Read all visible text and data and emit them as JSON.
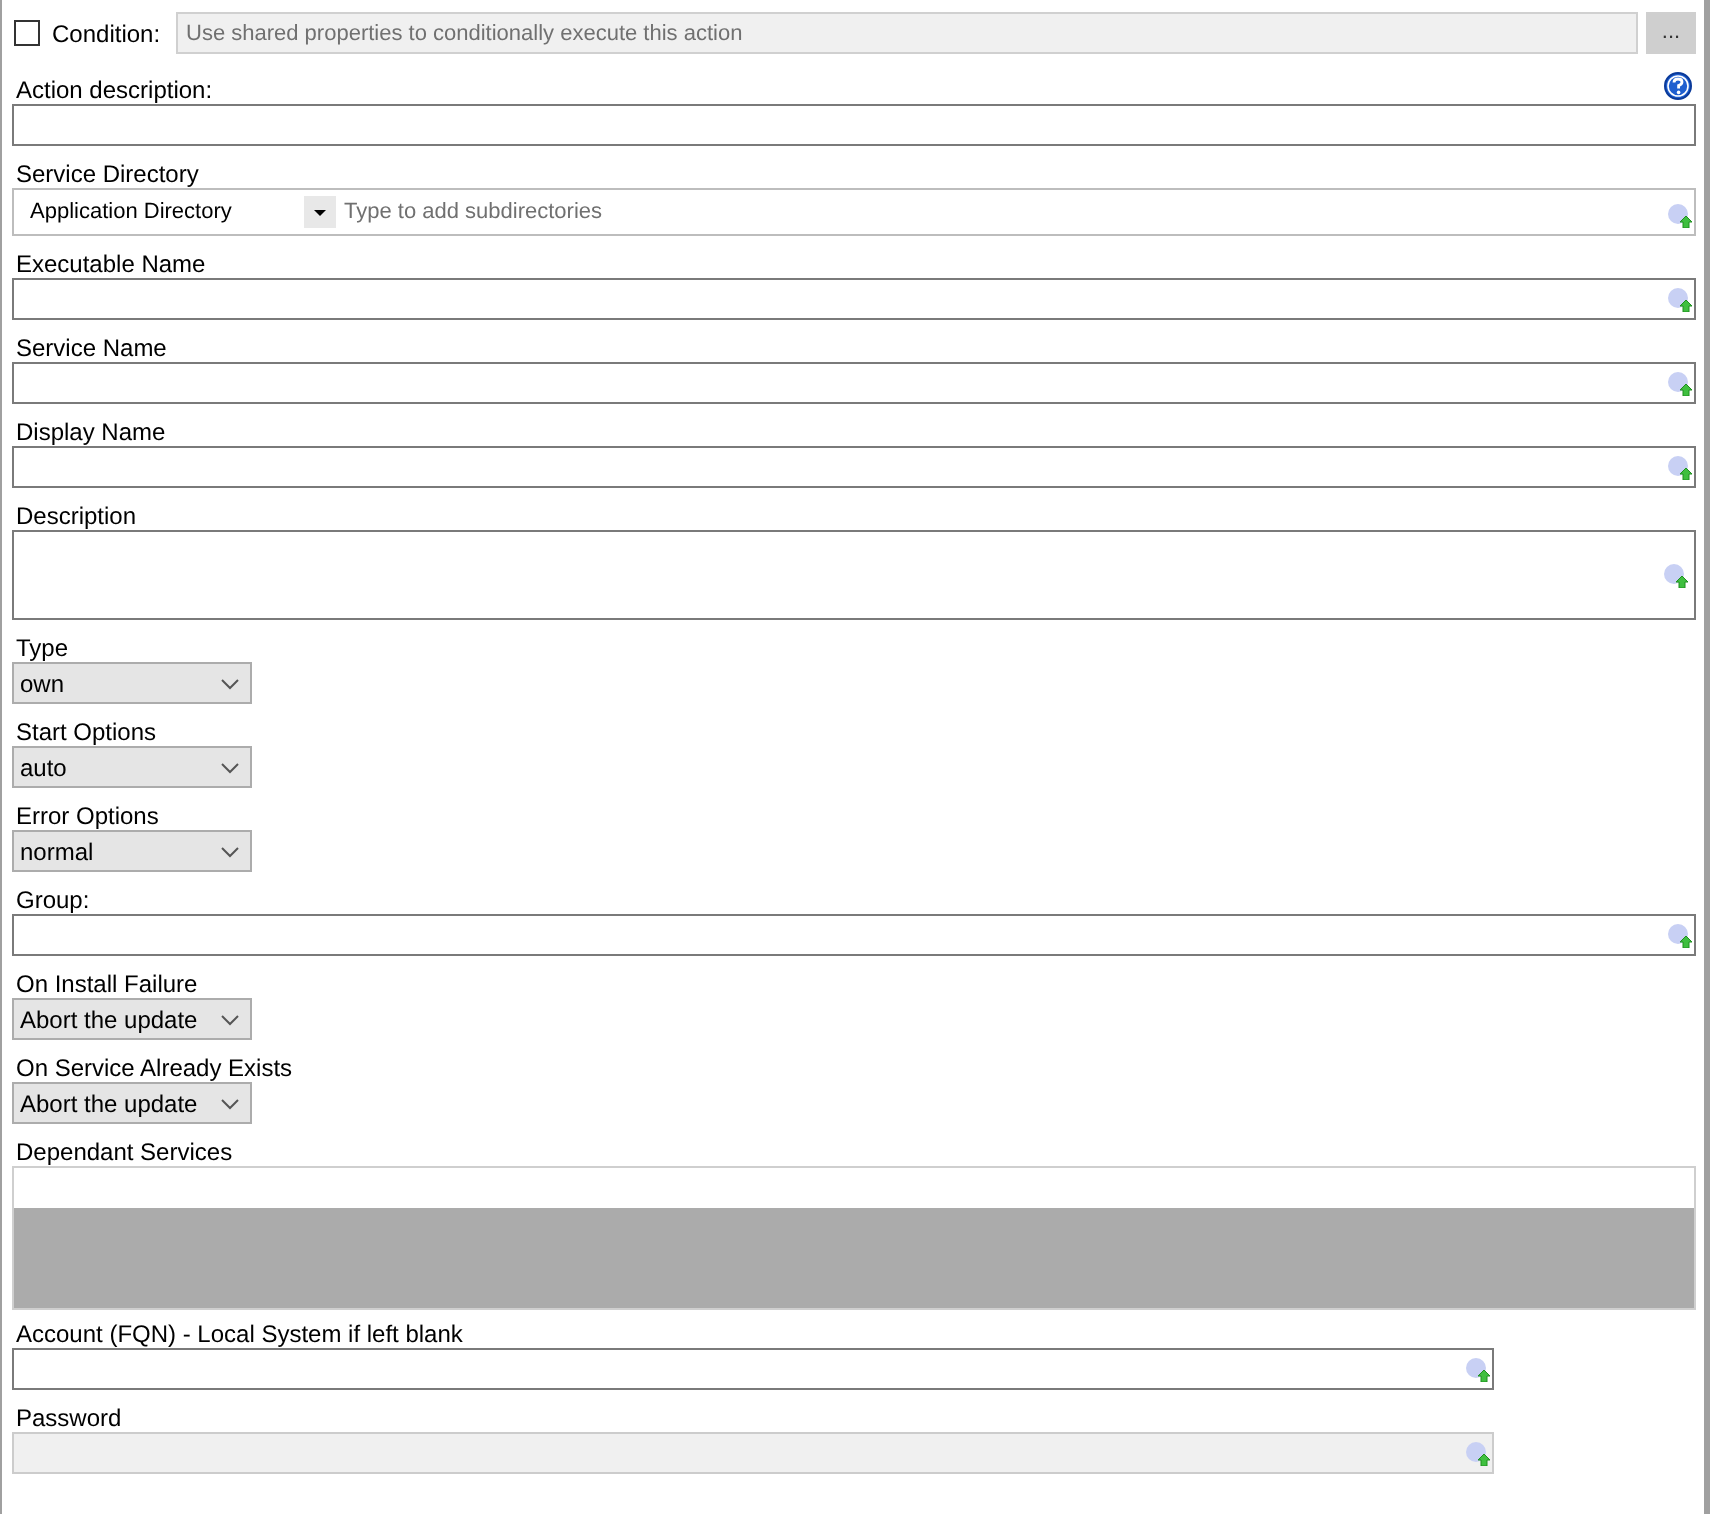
{
  "condition": {
    "checked": false,
    "label": "Condition:",
    "placeholder": "Use shared properties to conditionally execute this action",
    "button": "..."
  },
  "fields": [
    {
      "kind": "plain",
      "label": "Action description:",
      "help": true
    },
    {
      "kind": "directory",
      "label": "Service Directory",
      "value": "Application Directory",
      "placeholder": "Type to add subdirectories"
    },
    {
      "kind": "text",
      "label": "Executable Name"
    },
    {
      "kind": "text",
      "label": "Service Name"
    },
    {
      "kind": "text",
      "label": "Display Name"
    },
    {
      "kind": "textarea",
      "label": "Description"
    },
    {
      "kind": "select",
      "label": "Type",
      "value": "own"
    },
    {
      "kind": "select",
      "label": "Start Options",
      "value": "auto"
    },
    {
      "kind": "select",
      "label": "Error Options",
      "value": "normal"
    },
    {
      "kind": "text",
      "label": "Group:"
    },
    {
      "kind": "select",
      "label": "On Install Failure",
      "value": "Abort the update"
    },
    {
      "kind": "select",
      "label": "On Service Already Exists",
      "value": "Abort the update"
    },
    {
      "kind": "list",
      "label": "Dependant Services"
    },
    {
      "kind": "narrow",
      "label": "Account (FQN) - Local System if left blank",
      "disabled": false
    },
    {
      "kind": "narrow",
      "label": "Password",
      "disabled": true
    }
  ]
}
